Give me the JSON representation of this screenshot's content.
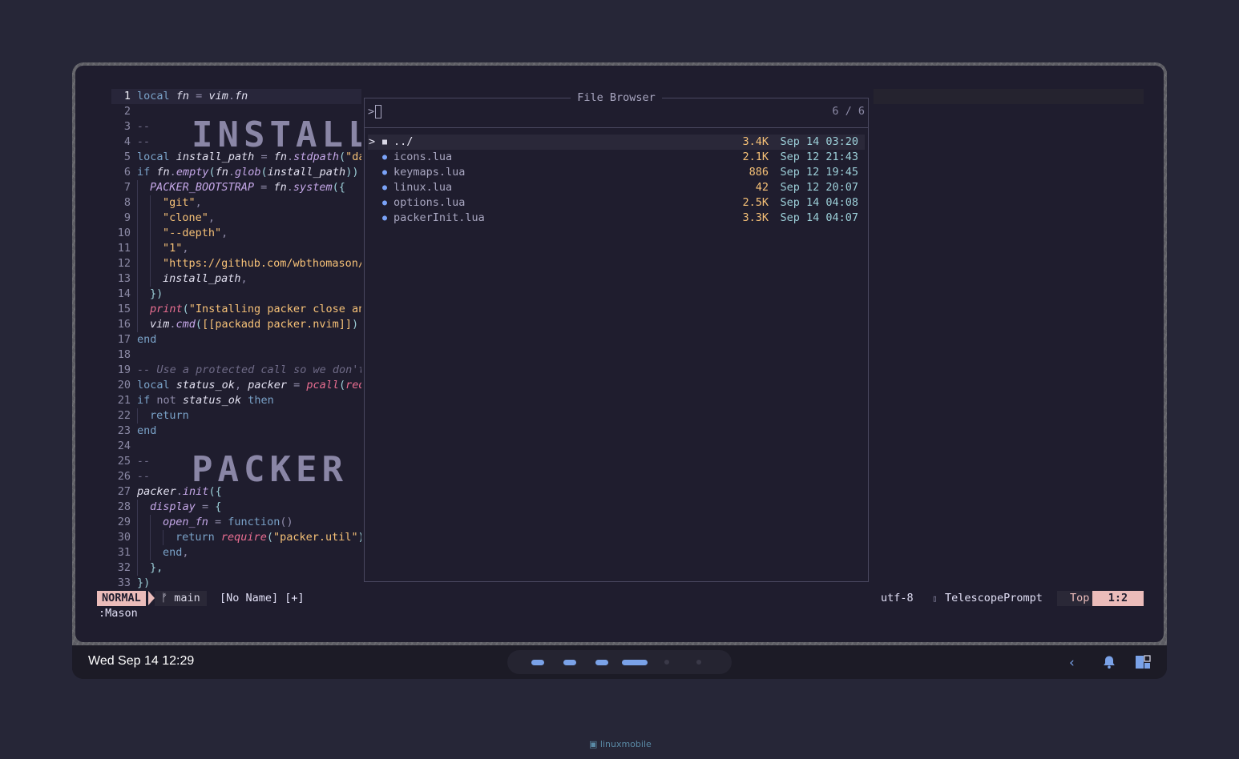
{
  "editor": {
    "line_numbers": [
      "1",
      "2",
      "3",
      "4",
      "5",
      "6",
      "7",
      "8",
      "9",
      "10",
      "11",
      "12",
      "13",
      "14",
      "15",
      "16",
      "17",
      "18",
      "19",
      "20",
      "21",
      "22",
      "23",
      "24",
      "25",
      "26",
      "27",
      "28",
      "29",
      "30",
      "31",
      "32",
      "33"
    ],
    "big_text_1": "INSTALL P",
    "big_text_2": "PACKER PC",
    "code": {
      "l1_kw": "local",
      "l1_var": "fn",
      "l1_eq": " = ",
      "l1_vim": "vim",
      "l1_dot": ".",
      "l1_fn": "fn",
      "l3": "--",
      "l4": "--",
      "l5_kw": "local",
      "l5_var": "install_path",
      "l5_eq": " = ",
      "l5_fn": "fn",
      "l5_dot": ".",
      "l5_call": "stdpath",
      "l5_paren": "(",
      "l5_str": "\"da",
      "l6_kw": "if",
      "l6_fn": "fn",
      "l6_dot": ".",
      "l6_call": "empty",
      "l6_p1": "(",
      "l6_fn2": "fn",
      "l6_dot2": ".",
      "l6_call2": "glob",
      "l6_p2": "(",
      "l6_arg": "install_path",
      "l6_p3": "))",
      "l7_var": "PACKER_BOOTSTRAP",
      "l7_eq": " = ",
      "l7_fn": "fn",
      "l7_dot": ".",
      "l7_call": "system",
      "l7_p": "({",
      "l8_str": "\"git\"",
      "l8_c": ",",
      "l9_str": "\"clone\"",
      "l9_c": ",",
      "l10_str": "\"--depth\"",
      "l10_c": ",",
      "l11_str": "\"1\"",
      "l11_c": ",",
      "l12_str": "\"https://github.com/wbthomason/",
      "l13_var": "install_path",
      "l13_c": ",",
      "l14": "})",
      "l15_call": "print",
      "l15_p": "(",
      "l15_str": "\"Installing packer close an",
      "l16_var": "vim",
      "l16_dot": ".",
      "l16_call": "cmd",
      "l16_p": "(",
      "l16_str": "[[packadd packer.nvim]]",
      "l16_p2": ")",
      "l17": "end",
      "l19": "-- Use a protected call so we don't",
      "l20_kw": "local",
      "l20_v1": "status_ok",
      "l20_c": ", ",
      "l20_v2": "packer",
      "l20_eq": " = ",
      "l20_call": "pcall",
      "l20_p": "(",
      "l20_arg": "req",
      "l21_kw": "if",
      "l21_not": " not ",
      "l21_var": "status_ok",
      "l21_then": " then",
      "l22": "return",
      "l23": "end",
      "l25": "--",
      "l26": "--",
      "l27_var": "packer",
      "l27_dot": ".",
      "l27_call": "init",
      "l27_p": "({",
      "l28_var": "display",
      "l28_eq": " = ",
      "l28_p": "{",
      "l29_var": "open_fn",
      "l29_eq": " = ",
      "l29_kw": "function",
      "l29_p": "()",
      "l30_kw": "return",
      "l30_call": "require",
      "l30_p": "(",
      "l30_str": "\"packer.util\"",
      "l30_p2": ")",
      "l31_kw": "end",
      "l31_c": ",",
      "l32": "},",
      "l33": "})"
    }
  },
  "file_browser": {
    "title": "File Browser",
    "prompt": ">",
    "count": "6 / 6",
    "selected_marker": ">",
    "files": [
      {
        "icon": "folder-icon",
        "name": "../",
        "size": "3.4K",
        "date": "Sep 14 03:20"
      },
      {
        "icon": "lua-icon",
        "name": "icons.lua",
        "size": "2.1K",
        "date": "Sep 12 21:43"
      },
      {
        "icon": "lua-icon",
        "name": "keymaps.lua",
        "size": "886",
        "date": "Sep 12 19:45"
      },
      {
        "icon": "lua-icon",
        "name": "linux.lua",
        "size": "42",
        "date": "Sep 12 20:07"
      },
      {
        "icon": "lua-icon",
        "name": "options.lua",
        "size": "2.5K",
        "date": "Sep 14 04:08"
      },
      {
        "icon": "lua-icon",
        "name": "packerInit.lua",
        "size": "3.3K",
        "date": "Sep 14 04:07"
      }
    ]
  },
  "statusline": {
    "mode": "NORMAL",
    "branch_icon": "ᚠ",
    "branch": "main",
    "buffer": "[No Name] [+]",
    "encoding": "utf-8",
    "filetype": "TelescopePrompt",
    "position_label": "Top",
    "cursor": "1:2"
  },
  "cmdline": ":Mason",
  "panel": {
    "clock": "Wed Sep 14 12:29",
    "workspace_colors": {
      "active": "#7aa2e8",
      "empty": "#3a3948"
    }
  },
  "watermark": "linuxmobile",
  "colors": {
    "background": "#262637",
    "editor_bg": "#1f1d2e",
    "accent_pink": "#ebbcba",
    "accent_gold": "#f6c177",
    "accent_blue": "#7aa2e8"
  }
}
